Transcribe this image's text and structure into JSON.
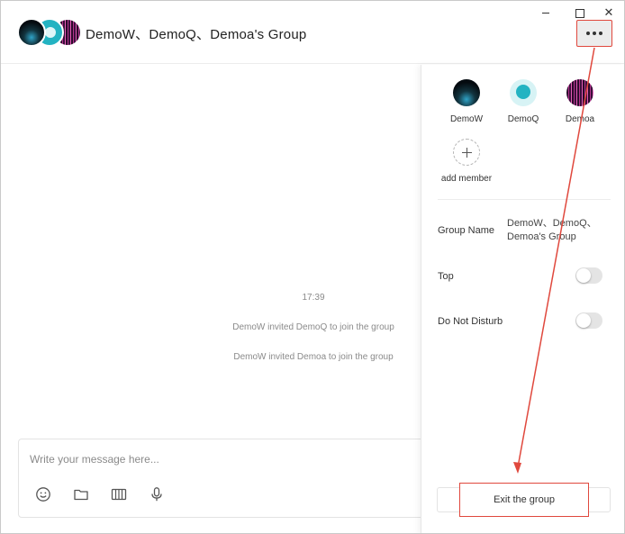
{
  "header": {
    "title": "DemoW、DemoQ、Demoa's Group",
    "avatars": [
      "DemoW",
      "DemoQ",
      "Demoa"
    ]
  },
  "window_controls": {
    "minimize_icon": "minimize-icon",
    "maximize_icon": "maximize-icon",
    "close_icon": "close-icon",
    "close_glyph": "✕"
  },
  "chat": {
    "time": "17:39",
    "system_messages": [
      "DemoW invited DemoQ to join the group",
      "DemoW invited Demoa to join the group"
    ],
    "composer": {
      "placeholder": "Write your message here...",
      "tools": [
        "emoji-icon",
        "folder-icon",
        "screenshot-icon",
        "microphone-icon"
      ]
    }
  },
  "panel": {
    "members": [
      {
        "name": "DemoW"
      },
      {
        "name": "DemoQ"
      },
      {
        "name": "Demoa"
      }
    ],
    "add_member_label": "add member",
    "group_name_label": "Group Name",
    "group_name_value": "DemoW、DemoQ、Demoa's Group",
    "top_label": "Top",
    "top_enabled": false,
    "dnd_label": "Do Not Disturb",
    "dnd_enabled": false,
    "exit_label": "Exit the group"
  },
  "colors": {
    "annotation": "#e0483d",
    "toggle_off": "#e4e4e4"
  }
}
